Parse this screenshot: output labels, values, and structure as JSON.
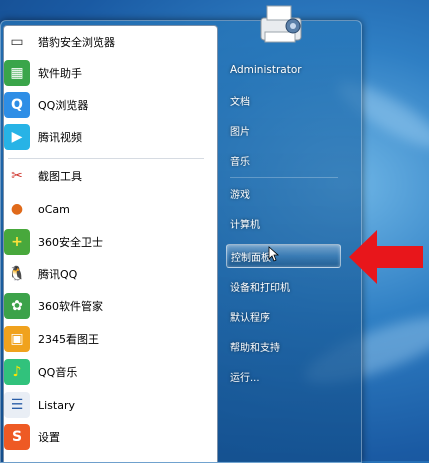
{
  "programs": [
    {
      "label": "猎豹安全浏览器",
      "icon": "cheetah-browser-icon",
      "color": "#ffffff",
      "fg": "#333333",
      "glyph": "▭"
    },
    {
      "label": "软件助手",
      "icon": "software-assistant-icon",
      "color": "#3aa54a",
      "fg": "#ffffff",
      "glyph": "▦"
    },
    {
      "label": "QQ浏览器",
      "icon": "qq-browser-icon",
      "color": "#2e8ee6",
      "fg": "#ffffff",
      "glyph": "Q"
    },
    {
      "label": "腾讯视频",
      "icon": "tencent-video-icon",
      "color": "#27b3e6",
      "fg": "#ffffff",
      "glyph": "▶"
    },
    {
      "label": "截图工具",
      "icon": "snipping-tool-icon",
      "color": "#ffffff",
      "fg": "#d0342c",
      "glyph": "✂"
    },
    {
      "label": "oCam",
      "icon": "ocam-icon",
      "color": "#ffffff",
      "fg": "#e06a1a",
      "glyph": "●"
    },
    {
      "label": "360安全卫士",
      "icon": "360-safe-icon",
      "color": "#48a83c",
      "fg": "#ffe23a",
      "glyph": "+"
    },
    {
      "label": "腾讯QQ",
      "icon": "qq-penguin-icon",
      "color": "#ffffff",
      "fg": "#111111",
      "glyph": "🐧"
    },
    {
      "label": "360软件管家",
      "icon": "360-software-manager-icon",
      "color": "#3ca24a",
      "fg": "#ffffff",
      "glyph": "✿"
    },
    {
      "label": "2345看图王",
      "icon": "2345-image-viewer-icon",
      "color": "#f0a21e",
      "fg": "#ffffff",
      "glyph": "▣"
    },
    {
      "label": "QQ音乐",
      "icon": "qq-music-icon",
      "color": "#31c27c",
      "fg": "#ffe600",
      "glyph": "♪"
    },
    {
      "label": "Listary",
      "icon": "listary-icon",
      "color": "#e9eef5",
      "fg": "#2a5ea8",
      "glyph": "☰"
    },
    {
      "label": "设置",
      "icon": "sogou-settings-icon",
      "color": "#ee5a24",
      "fg": "#ffffff",
      "glyph": "S"
    }
  ],
  "right_items": [
    {
      "label": "Administrator",
      "name": "user-name-item"
    },
    {
      "label": "文档",
      "name": "documents-item"
    },
    {
      "label": "图片",
      "name": "pictures-item"
    },
    {
      "label": "音乐",
      "name": "music-item"
    },
    {
      "label": "游戏",
      "name": "games-item"
    },
    {
      "label": "计算机",
      "name": "computer-item"
    },
    {
      "label": "控制面板",
      "name": "control-panel-item"
    },
    {
      "label": "设备和打印机",
      "name": "devices-printers-item"
    },
    {
      "label": "默认程序",
      "name": "default-programs-item"
    },
    {
      "label": "帮助和支持",
      "name": "help-support-item"
    },
    {
      "label": "运行...",
      "name": "run-item"
    }
  ],
  "highlighted_item": "控制面板",
  "annotation_arrow_color": "#e8161b"
}
